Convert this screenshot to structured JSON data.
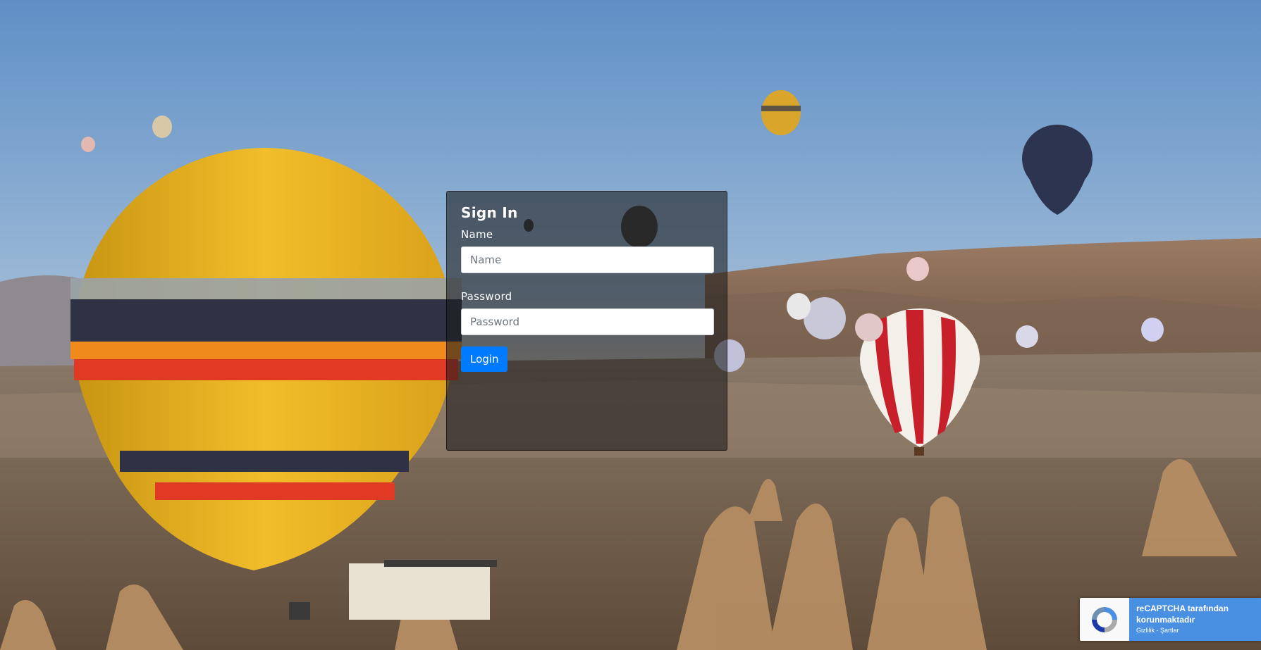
{
  "login": {
    "title": "Sign In",
    "name_label": "Name",
    "name_placeholder": "Name",
    "name_value": "",
    "password_label": "Password",
    "password_placeholder": "Password",
    "password_value": "",
    "submit_label": "Login"
  },
  "recaptcha": {
    "line1": "reCAPTCHA tarafından",
    "line2": "korunmaktadır",
    "privacy_link": "Gizlilik",
    "separator": " - ",
    "terms_link": "Şartlar",
    "logo_icon": "recaptcha-logo-icon"
  },
  "theme": {
    "accent": "#007bff",
    "recaptcha_blue": "#4a90e2",
    "card_bg": "rgba(25,25,25,0.58)"
  }
}
